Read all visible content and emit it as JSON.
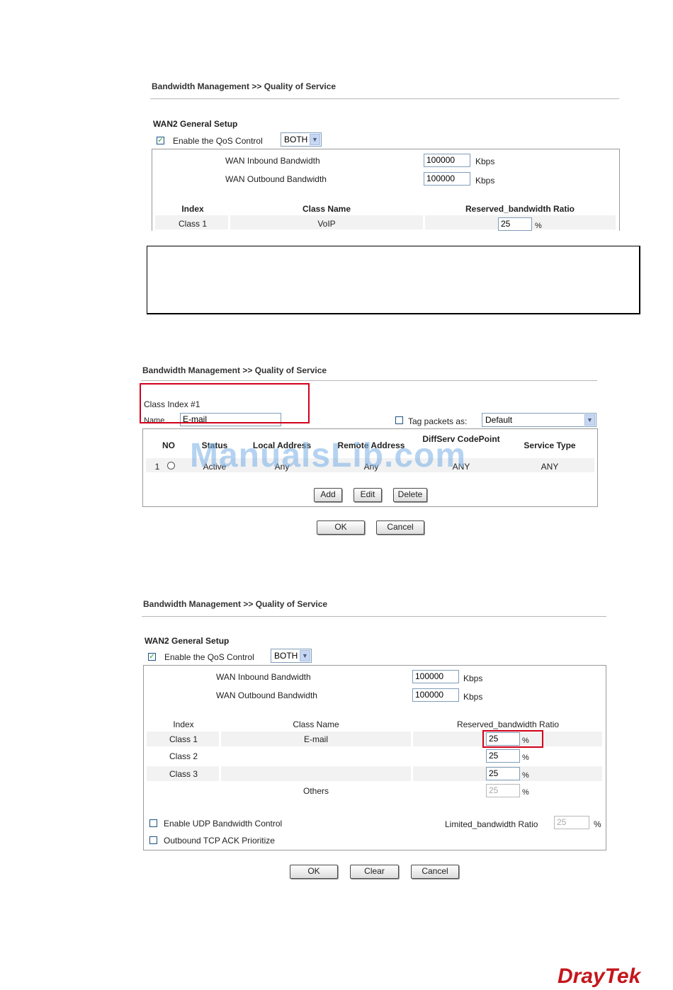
{
  "breadcrumb": "Bandwidth Management >> Quality of Service",
  "figure1": {
    "section_title": "WAN2 General Setup",
    "enable_qos_label": "Enable the QoS Control",
    "enable_qos_checked": true,
    "direction": "BOTH",
    "inbound_label": "WAN Inbound Bandwidth",
    "inbound_value": "100000",
    "outbound_label": "WAN Outbound Bandwidth",
    "outbound_value": "100000",
    "unit": "Kbps",
    "columns": [
      "Index",
      "Class Name",
      "Reserved_bandwidth Ratio"
    ],
    "rows": [
      {
        "index": "Class 1",
        "name": "VoIP",
        "ratio": "25"
      }
    ],
    "percent": "%"
  },
  "figure2": {
    "class_index": "Class Index #1",
    "name_label": "Name",
    "name_value": "E-mail",
    "tag_label": "Tag packets as:",
    "tag_value": "Default",
    "columns": [
      "NO",
      "Status",
      "Local Address",
      "Remote Address",
      "DiffServ CodePoint",
      "Service Type"
    ],
    "rows": [
      {
        "no": "1",
        "status": "Active",
        "local": "Any",
        "remote": "Any",
        "diffserv": "ANY",
        "service": "ANY"
      }
    ],
    "add": "Add",
    "edit": "Edit",
    "delete": "Delete",
    "ok": "OK",
    "cancel": "Cancel",
    "watermark": "ManualsLib.com"
  },
  "figure3": {
    "section_title": "WAN2 General Setup",
    "enable_qos_label": "Enable the QoS Control",
    "enable_qos_checked": true,
    "direction": "BOTH",
    "inbound_label": "WAN Inbound Bandwidth",
    "inbound_value": "100000",
    "outbound_label": "WAN Outbound Bandwidth",
    "outbound_value": "100000",
    "unit": "Kbps",
    "columns": [
      "Index",
      "Class Name",
      "Reserved_bandwidth Ratio"
    ],
    "rows": [
      {
        "index": "Class 1",
        "name": "E-mail",
        "ratio": "25"
      },
      {
        "index": "Class 2",
        "name": "",
        "ratio": "25"
      },
      {
        "index": "Class 3",
        "name": "",
        "ratio": "25"
      },
      {
        "index": "",
        "name": "Others",
        "ratio": "25"
      }
    ],
    "percent": "%",
    "udp_label": "Enable UDP Bandwidth Control",
    "limited_label": "Limited_bandwidth Ratio",
    "limited_value": "25",
    "tcp_ack_label": "Outbound TCP ACK Prioritize",
    "ok": "OK",
    "clear": "Clear",
    "cancel": "Cancel"
  },
  "logo": {
    "part1": "Dray",
    "part2": "Tek"
  },
  "colors": {
    "highlight": "#d3001c",
    "brand": "#c4161c"
  }
}
